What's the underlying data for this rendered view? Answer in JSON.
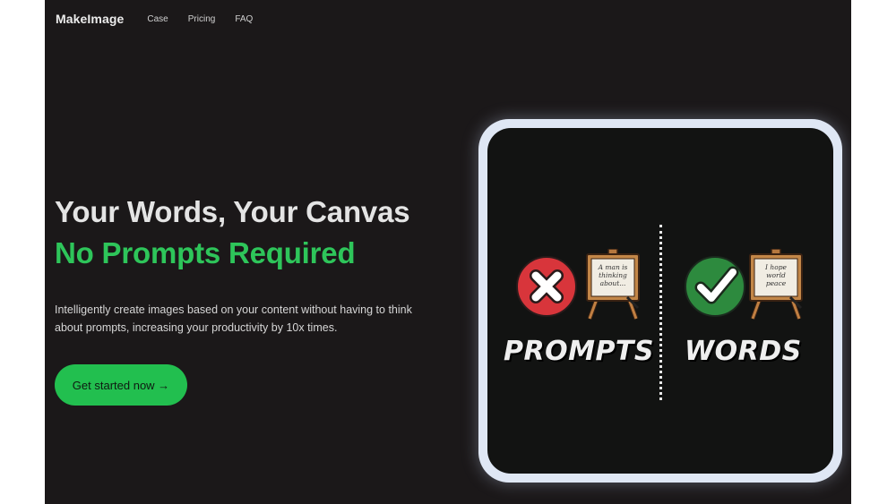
{
  "nav": {
    "brand": "MakeImage",
    "links": [
      "Case",
      "Pricing",
      "FAQ"
    ]
  },
  "hero": {
    "title_line1": "Your Words, Your Canvas",
    "title_line2": "No Prompts Required",
    "description": "Intelligently create images based on your content without having to think about prompts, increasing your productivity by 10x times.",
    "cta_label": "Get started now →"
  },
  "illustration": {
    "left_label": "PROMPTS",
    "right_label": "WORDS",
    "left_easel_text": "A man is thinking about...",
    "right_easel_text": "I hope world peace",
    "left_icon": "x-mark-icon",
    "right_icon": "check-mark-icon"
  },
  "colors": {
    "accent_green": "#22bf4f",
    "background": "#1b1819",
    "card_border": "#dfe7f4",
    "red": "#d8353b"
  }
}
